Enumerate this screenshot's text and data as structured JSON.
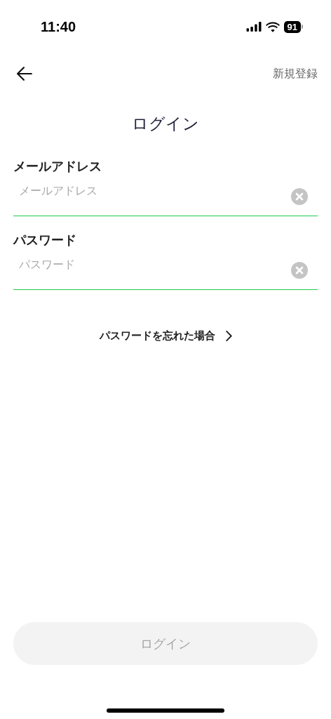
{
  "status_bar": {
    "time": "11:40",
    "battery": "91"
  },
  "nav": {
    "action": "新規登録"
  },
  "title": "ログイン",
  "fields": [
    {
      "label": "メールアドレス",
      "placeholder": "メールアドレス"
    },
    {
      "label": "パスワード",
      "placeholder": "パスワード"
    }
  ],
  "forgot_link": "パスワードを忘れた場合",
  "login_button": {
    "label": "ログイン",
    "disabled": true
  }
}
